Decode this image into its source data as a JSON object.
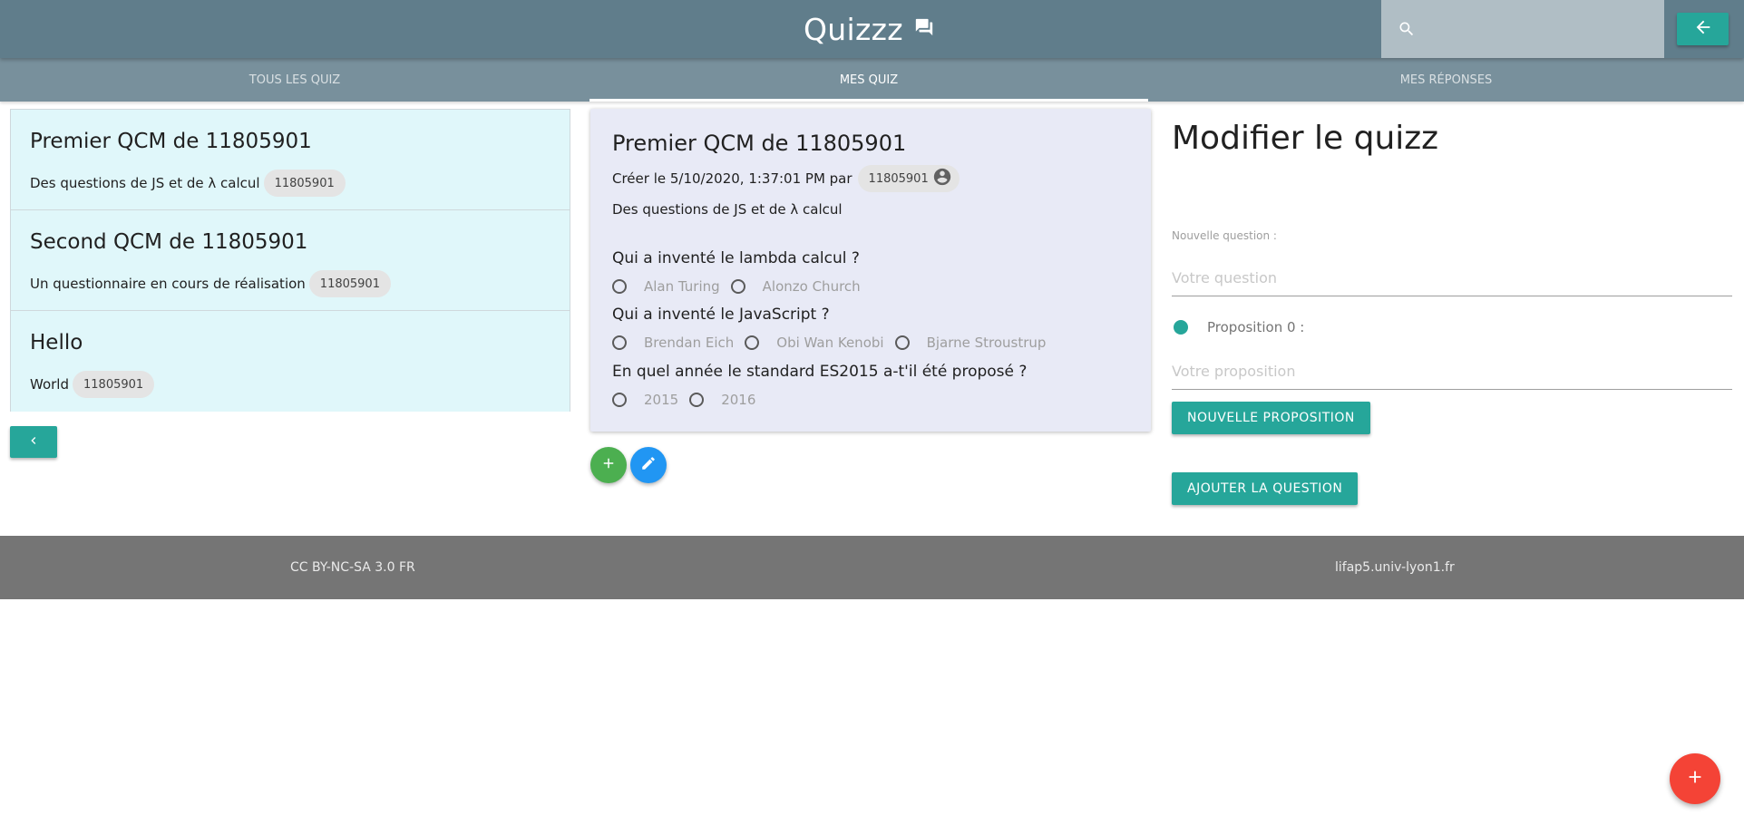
{
  "header": {
    "title": "Quizzz",
    "title_icon": "forum-icon",
    "search_placeholder": "",
    "search_icon": "search-icon",
    "back_icon": "arrow-back-icon"
  },
  "tabs": [
    {
      "label": "TOUS LES QUIZ",
      "active": false
    },
    {
      "label": "MES QUIZ",
      "active": true
    },
    {
      "label": "MES RÉPONSES",
      "active": false
    }
  ],
  "quiz_list": {
    "items": [
      {
        "title": "Premier QCM de 11805901",
        "description": "Des questions de JS et de λ calcul",
        "owner": "11805901"
      },
      {
        "title": "Second QCM de 11805901",
        "description": "Un questionnaire en cours de réalisation",
        "owner": "11805901"
      },
      {
        "title": "Hello",
        "description": "World",
        "owner": "11805901"
      }
    ],
    "prev_icon": "chevron-left-icon"
  },
  "detail": {
    "title": "Premier QCM de 11805901",
    "created_prefix": "Créer le 5/10/2020, 1:37:01 PM par",
    "owner": "11805901",
    "owner_icon": "account-circle-icon",
    "description": "Des questions de JS et de λ calcul",
    "questions": [
      {
        "text": "Qui a inventé le lambda calcul ?",
        "options": [
          "Alan Turing",
          "Alonzo Church"
        ]
      },
      {
        "text": "Qui a inventé le JavaScript ?",
        "options": [
          "Brendan Eich",
          "Obi Wan Kenobi",
          "Bjarne Stroustrup"
        ]
      },
      {
        "text": "En quel année le standard ES2015 a-t'il été proposé ?",
        "options": [
          "2015",
          "2016"
        ]
      }
    ],
    "add_icon": "plus-icon",
    "edit_icon": "pencil-icon"
  },
  "editor": {
    "title": "Modifier le quizz",
    "question_label": "Nouvelle question :",
    "question_placeholder": "Votre question",
    "proposition_label": "Proposition 0 :",
    "proposition_placeholder": "Votre proposition",
    "new_proposition_button": "NOUVELLE PROPOSITION",
    "add_question_button": "AJOUTER LA QUESTION"
  },
  "footer": {
    "license": "CC BY-NC-SA 3.0 FR",
    "site": "lifap5.univ-lyon1.fr"
  },
  "fab": {
    "icon": "plus-icon"
  },
  "colors": {
    "header": "#607d8b",
    "tabs": "#78909c",
    "teal": "#26a69a",
    "quiz_item_bg": "#e0f7fa",
    "detail_bg": "#e8eaf6",
    "green_fab": "#4caf50",
    "blue_fab": "#2196f3",
    "red_fab": "#f44336",
    "footer": "#757575"
  }
}
